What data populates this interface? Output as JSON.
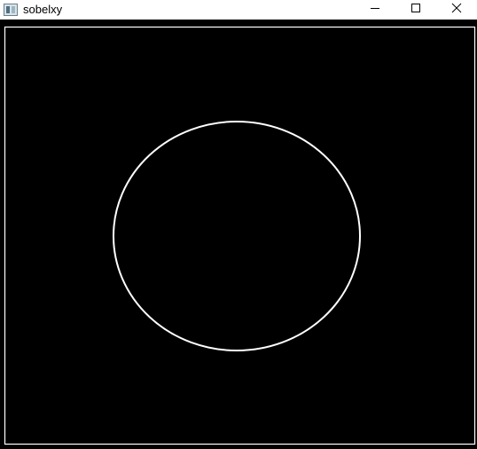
{
  "window": {
    "title": "sobelxy",
    "icons": {
      "app": "app-window-icon",
      "minimize": "minimize-icon",
      "maximize": "maximize-icon",
      "close": "close-icon"
    }
  },
  "colors": {
    "titlebar_bg": "#ffffff",
    "canvas_bg": "#000000",
    "edge_color": "#ffffff"
  }
}
